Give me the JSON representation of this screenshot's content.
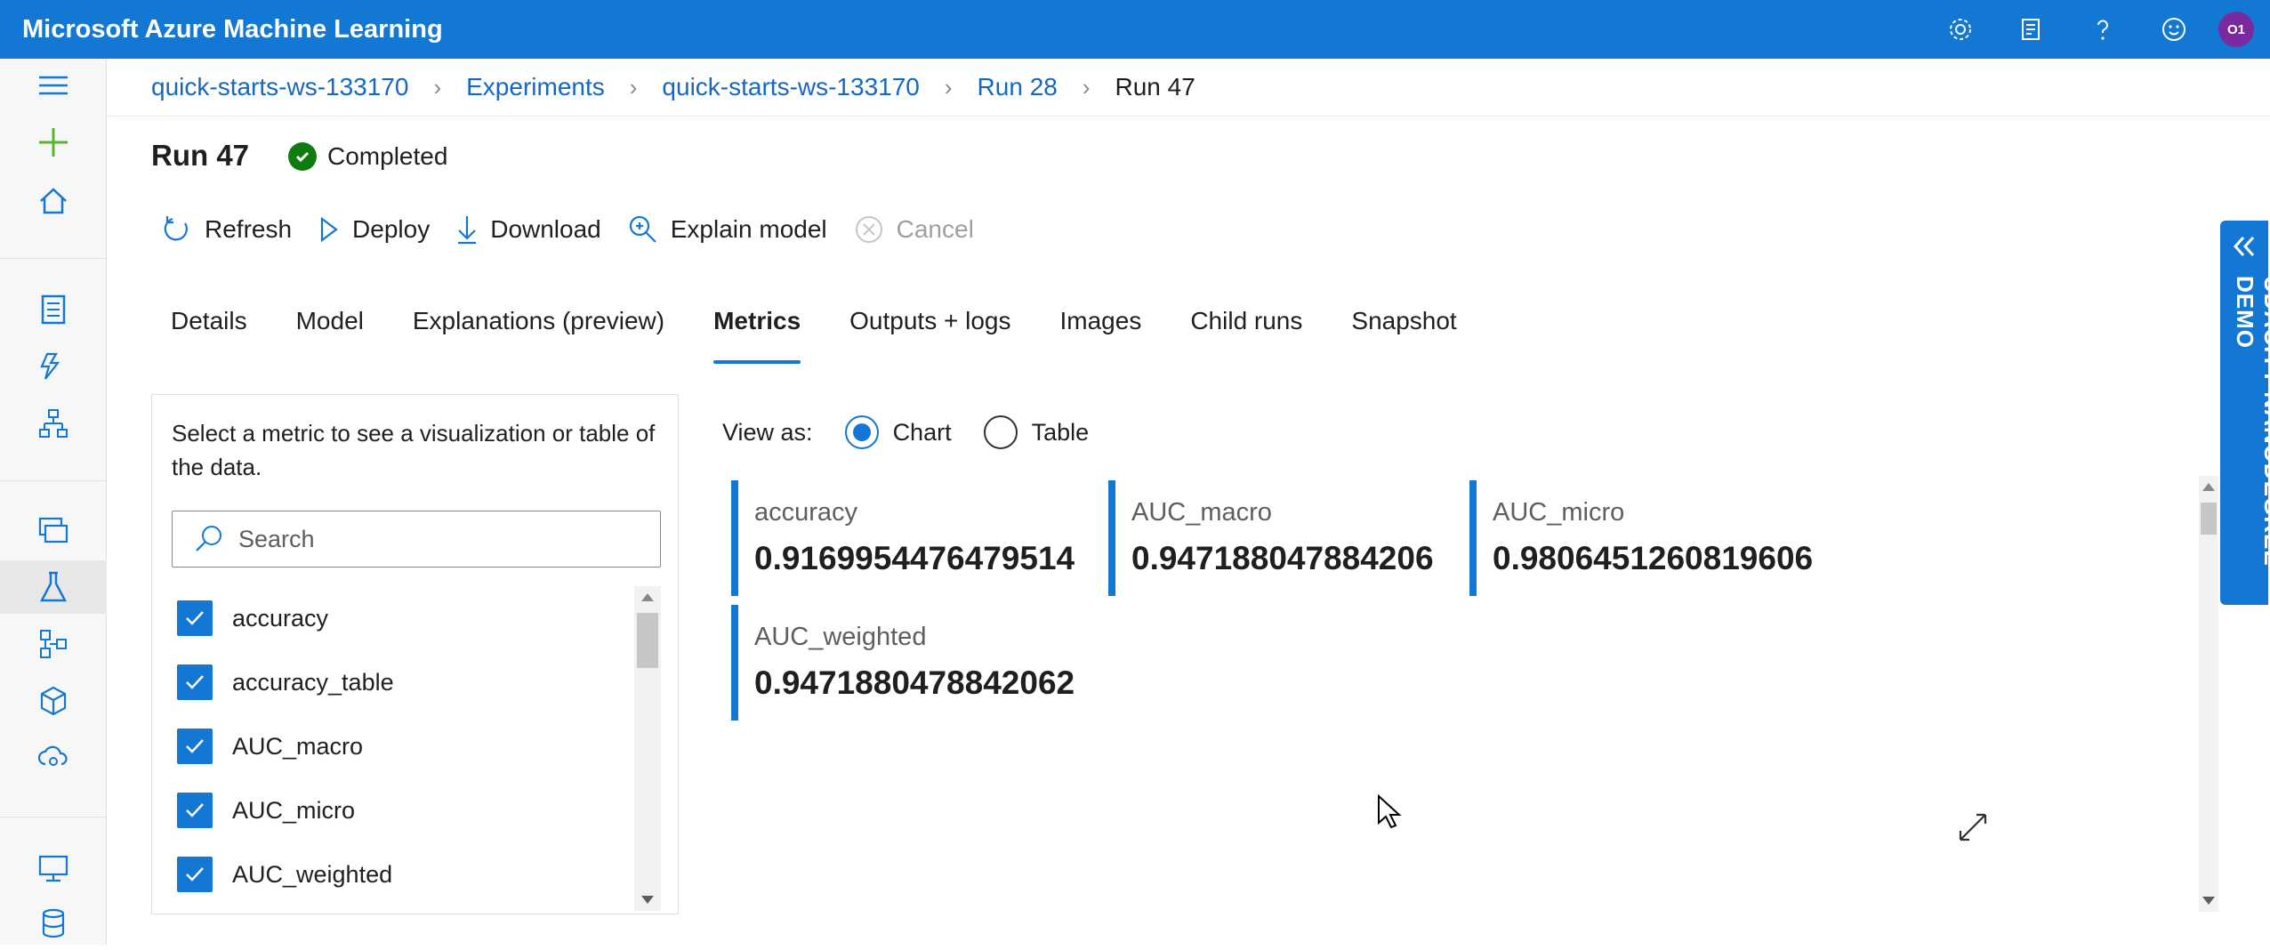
{
  "app": {
    "title": "Microsoft Azure Machine Learning",
    "avatar_initials": "O1"
  },
  "breadcrumb": [
    "quick-starts-ws-133170",
    "Experiments",
    "quick-starts-ws-133170",
    "Run 28",
    "Run 47"
  ],
  "run": {
    "title": "Run 47",
    "status": "Completed"
  },
  "toolbar": {
    "refresh": "Refresh",
    "deploy": "Deploy",
    "download": "Download",
    "explain": "Explain model",
    "cancel": "Cancel"
  },
  "tabs": [
    "Details",
    "Model",
    "Explanations (preview)",
    "Metrics",
    "Outputs + logs",
    "Images",
    "Child runs",
    "Snapshot"
  ],
  "active_tab": "Metrics",
  "metrics_panel": {
    "description": "Select a metric to see a visualization or table of the data.",
    "search_placeholder": "Search",
    "items": [
      "accuracy",
      "accuracy_table",
      "AUC_macro",
      "AUC_micro",
      "AUC_weighted"
    ]
  },
  "view_as": {
    "label": "View as:",
    "chart": "Chart",
    "table": "Table",
    "selected": "Chart"
  },
  "cards": [
    {
      "name": "accuracy",
      "value": "0.9169954476479514"
    },
    {
      "name": "AUC_macro",
      "value": "0.947188047884206"
    },
    {
      "name": "AUC_micro",
      "value": "0.9806451260819606"
    },
    {
      "name": "AUC_weighted",
      "value": "0.9471880478842062"
    }
  ],
  "side_tab": {
    "label": "UDACITY NANODEGREE DEMO"
  },
  "colors": {
    "accent": "#1377d4",
    "success": "#107c10"
  }
}
